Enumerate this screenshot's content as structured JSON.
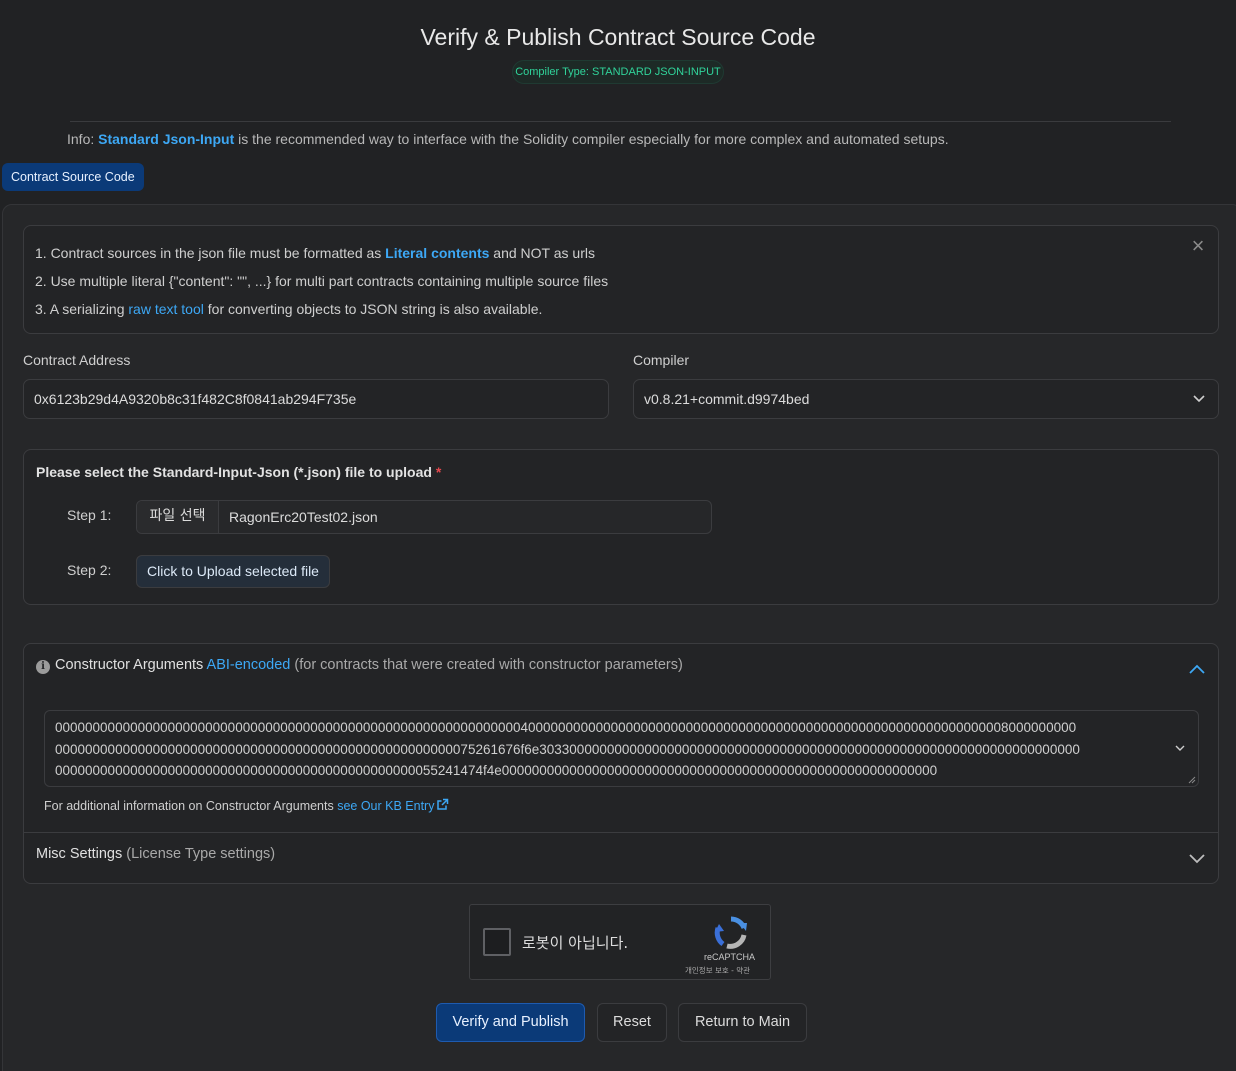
{
  "header": {
    "title": "Verify & Publish Contract Source Code",
    "compiler_type_badge": "Compiler Type: STANDARD JSON-INPUT"
  },
  "info": {
    "prefix": "Info: ",
    "link": "Standard Json-Input",
    "suffix": " is the recommended way to interface with the Solidity compiler especially for more complex and automated setups."
  },
  "tab": {
    "label": "Contract Source Code"
  },
  "notice": {
    "line1_prefix": "1. Contract sources in the json file must be formatted as ",
    "line1_link": "Literal contents",
    "line1_suffix": " and NOT as urls",
    "line2": "2. Use multiple literal {\"content\": \"\", ...} for multi part contracts containing multiple source files",
    "line3_prefix": "3. A serializing ",
    "line3_link": "raw text tool",
    "line3_suffix": " for converting objects to JSON string is also available.",
    "close_icon": "×"
  },
  "contract_address": {
    "label": "Contract Address",
    "value": "0x6123b29d4A9320b8c31f482C8f0841ab294F735e"
  },
  "compiler": {
    "label": "Compiler",
    "value": "v0.8.21+commit.d9974bed"
  },
  "upload": {
    "title": "Please select the Standard-Input-Json (*.json) file to upload",
    "required_mark": "*",
    "step1_label": "Step 1:",
    "file_button": "파일 선택",
    "file_name": "RagonErc20Test02.json",
    "step2_label": "Step 2:",
    "upload_button": "Click to Upload selected file"
  },
  "constructor": {
    "info_icon": "i",
    "title": "Constructor Arguments",
    "link": "ABI-encoded",
    "subtitle": "(for contracts that were created with constructor parameters)",
    "lines": [
      "0000000000000000000000000000000000000000000000000000000000000040000000000000000000000000000000000000000000000000000000000000008000000000",
      "00000000000000000000000000000000000000000000000000000075261676f6e303300000000000000000000000000000000000000000000000000000000000000000000",
      "000000000000000000000000000000000000000000000000055241474f4e0000000000000000000000000000000000000000000000000000000000"
    ],
    "kb_prefix": "For additional information on Constructor Arguments ",
    "kb_link": "see Our KB Entry"
  },
  "misc": {
    "title": "Misc Settings",
    "subtitle": "(License Type settings)"
  },
  "captcha": {
    "label": "로봇이 아닙니다.",
    "brand": "reCAPTCHA",
    "links": "개인정보 보호 - 약관"
  },
  "actions": {
    "verify": "Verify and Publish",
    "reset": "Reset",
    "return": "Return to Main"
  },
  "colors": {
    "background": "#212224",
    "accent_link": "#3da8f5",
    "primary_button": "#0b3a78",
    "badge_green": "#30d39a"
  }
}
